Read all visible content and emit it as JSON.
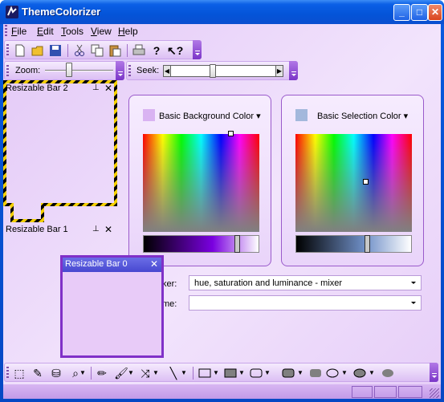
{
  "window": {
    "title": "ThemeColorizer"
  },
  "menu": {
    "items": [
      {
        "label": "File",
        "mnemonic": "F",
        "rest": "ile"
      },
      {
        "label": "Edit",
        "mnemonic": "E",
        "rest": "dit"
      },
      {
        "label": "Tools",
        "mnemonic": "T",
        "rest": "ools"
      },
      {
        "label": "View",
        "mnemonic": "V",
        "rest": "iew"
      },
      {
        "label": "Help",
        "mnemonic": "H",
        "rest": "elp"
      }
    ]
  },
  "toolbar": {
    "zoom_label": "Zoom:",
    "seek_label": "Seek:",
    "zoom_value": 0.35,
    "seek_value": 0.4
  },
  "dock": {
    "bar2_title": "Resizable Bar 2",
    "bar1_title": "Resizable Bar 1",
    "bar0_title": "Resizable Bar 0"
  },
  "colors": {
    "background_panel": {
      "title": "Basic Background Color",
      "swatch": "#d9b3f2"
    },
    "selection_panel": {
      "title": "Basic Selection Color",
      "swatch": "#a3b8dc"
    }
  },
  "fields": {
    "mixer_label_partial": "ker:",
    "mixer_value": "hue, saturation and luminance - mixer",
    "theme_label_partial": "me:",
    "theme_value": ""
  }
}
